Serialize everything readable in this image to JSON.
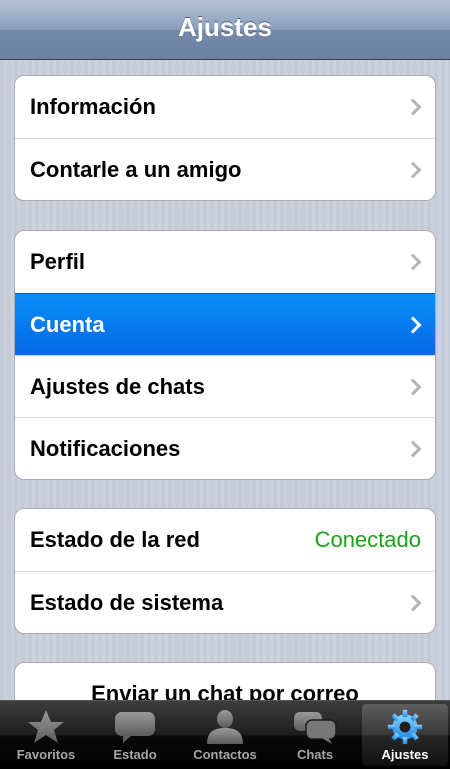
{
  "navbar": {
    "title": "Ajustes"
  },
  "group1": {
    "items": [
      {
        "label": "Información"
      },
      {
        "label": "Contarle a un amigo"
      }
    ]
  },
  "group2": {
    "items": [
      {
        "label": "Perfil"
      },
      {
        "label": "Cuenta"
      },
      {
        "label": "Ajustes de chats"
      },
      {
        "label": "Notificaciones"
      }
    ]
  },
  "group3": {
    "items": [
      {
        "label": "Estado de la red",
        "value": "Conectado"
      },
      {
        "label": "Estado de sistema"
      }
    ]
  },
  "group4": {
    "items": [
      {
        "label": "Enviar un chat por correo"
      }
    ]
  },
  "tabbar": {
    "tabs": [
      {
        "label": "Favoritos",
        "icon": "star-icon"
      },
      {
        "label": "Estado",
        "icon": "speech-bubble-icon"
      },
      {
        "label": "Contactos",
        "icon": "person-icon"
      },
      {
        "label": "Chats",
        "icon": "chat-bubbles-icon"
      },
      {
        "label": "Ajustes",
        "icon": "gear-icon"
      }
    ],
    "active": "Ajustes"
  },
  "colors": {
    "selected_row": "#0568e6",
    "status_connected": "#1aa01a",
    "accent_blue": "#2aa3ff"
  }
}
